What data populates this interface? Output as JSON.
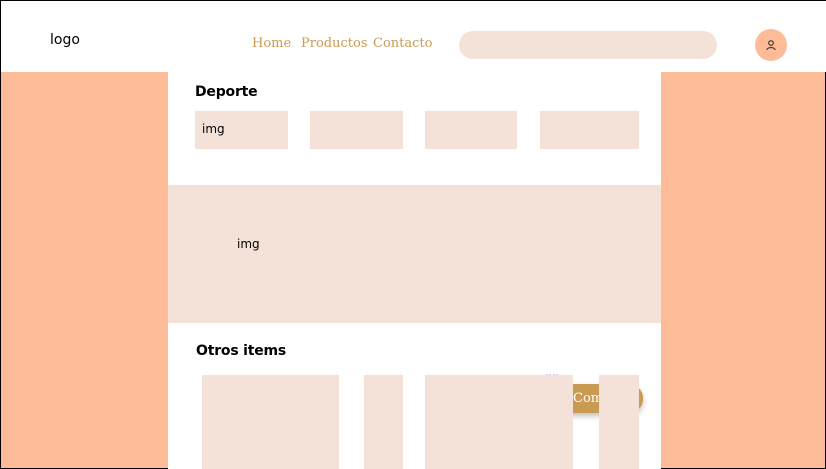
{
  "header": {
    "logo": "logo",
    "nav": [
      "Home",
      "Productos",
      "Contacto"
    ],
    "search": {
      "placeholder": "",
      "value": ""
    }
  },
  "deporte": {
    "title": "Deporte",
    "tiles": [
      "img",
      "",
      "",
      ""
    ]
  },
  "banner": {
    "image_label": "img",
    "buy_label": "Comprar"
  },
  "otros": {
    "title": "Otros items"
  },
  "colors": {
    "background": "#fdbb98",
    "tile": "#f4e2d8",
    "accent": "#c99a52"
  },
  "icons": [
    "user-icon",
    "truck-icon"
  ]
}
